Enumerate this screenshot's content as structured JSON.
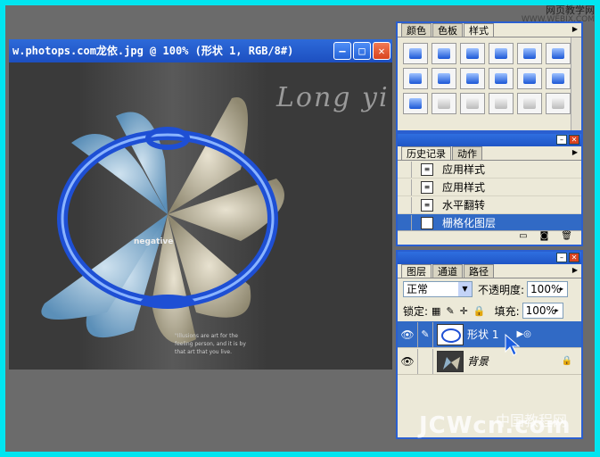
{
  "watermark_top": {
    "line1": "网页教学网",
    "line2": "WWW.WEBJX.COM"
  },
  "document": {
    "title": "w.photops.com龙依.jpg @ 100% (形状 1, RGB/8#)",
    "minimize": "—",
    "maximize": "□",
    "close": "✕",
    "art_text": "Long yi",
    "negative_text": "negative",
    "quote_lines": "\"Illusions are art for the feeling person, and it is by that art that you live."
  },
  "styles_panel": {
    "tabs": [
      "颜色",
      "色板",
      "样式"
    ]
  },
  "history_panel": {
    "tabs": [
      "历史记录",
      "动作"
    ],
    "items": [
      "应用样式",
      "应用样式",
      "水平翻转",
      "栅格化图层"
    ]
  },
  "layers_panel": {
    "tabs": [
      "图层",
      "通道",
      "路径"
    ],
    "blend_mode": "正常",
    "opacity_label": "不透明度:",
    "opacity_value": "100%",
    "lock_label": "锁定:",
    "fill_label": "填充:",
    "fill_value": "100%",
    "layers": [
      "形状 1",
      "背景"
    ]
  },
  "watermark_bottom": {
    "line1": "中国教程网",
    "line2": "JCWcn.com"
  },
  "colors": {
    "accent": "#316ac5",
    "background": "#00e5f0",
    "panel": "#ece9d8"
  }
}
